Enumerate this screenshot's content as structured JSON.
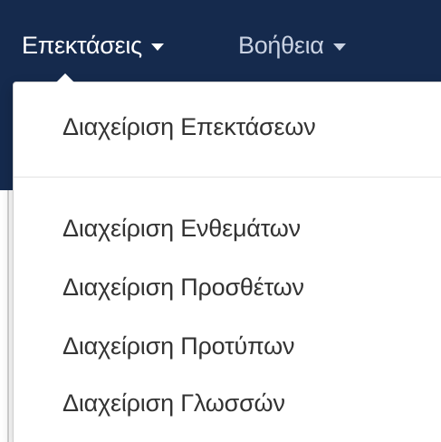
{
  "navbar": {
    "items": [
      {
        "label": "Επεκτάσεις",
        "has_caret": true,
        "active": true
      },
      {
        "label": "Βοήθεια",
        "has_caret": true,
        "active": false
      }
    ]
  },
  "dropdown": {
    "items": [
      {
        "label": "Διαχείριση Επεκτάσεων"
      },
      {
        "label": "Διαχείριση Ενθεμάτων"
      },
      {
        "label": "Διαχείριση Προσθέτων"
      },
      {
        "label": "Διαχείριση Προτύπων"
      },
      {
        "label": "Διαχείριση Γλωσσών"
      }
    ]
  },
  "colors": {
    "navbar_bg": "#152a4d",
    "menu_text": "#333333",
    "navbar_text": "#ffffff"
  }
}
